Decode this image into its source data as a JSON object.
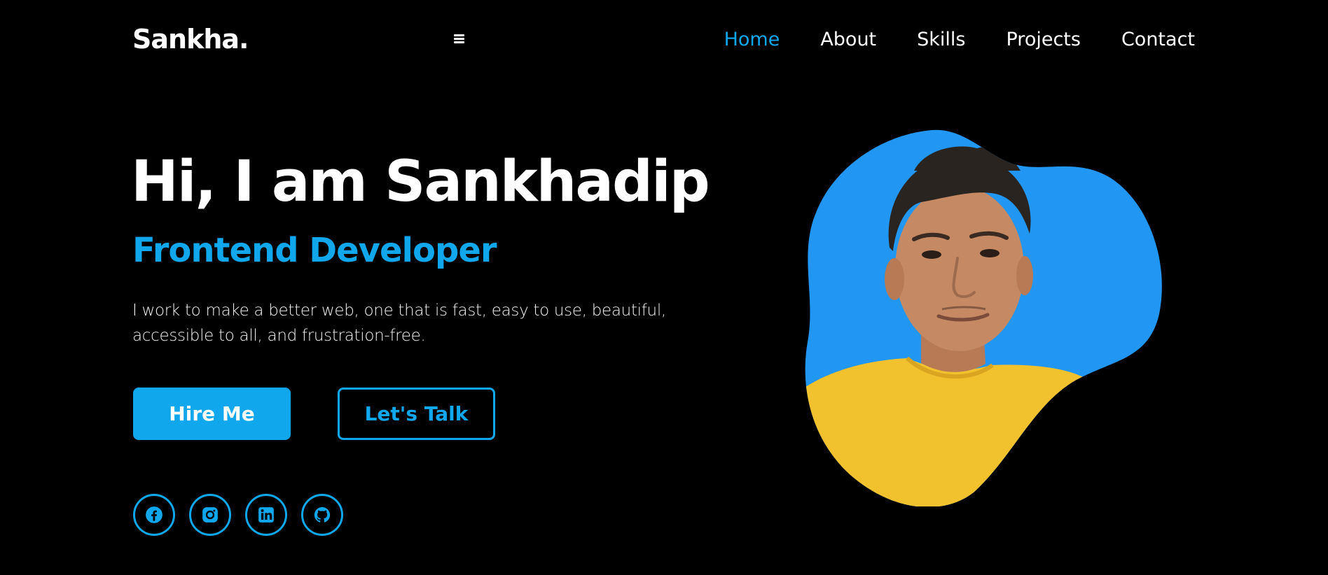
{
  "header": {
    "logo": "Sankha.",
    "menu_icon": "hamburger-menu-icon",
    "nav": [
      {
        "label": "Home",
        "active": true
      },
      {
        "label": "About",
        "active": false
      },
      {
        "label": "Skills",
        "active": false
      },
      {
        "label": "Projects",
        "active": false
      },
      {
        "label": "Contact",
        "active": false
      }
    ]
  },
  "hero": {
    "title": "Hi, I am Sankhadip",
    "role": "Frontend Developer",
    "description": "I work to make a better web, one that is fast, easy to use, beautiful, accessible to all, and frustration-free.",
    "hire_label": "Hire Me",
    "talk_label": "Let's Talk"
  },
  "social": [
    {
      "icon": "facebook-icon"
    },
    {
      "icon": "instagram-icon"
    },
    {
      "icon": "linkedin-icon"
    },
    {
      "icon": "github-icon"
    }
  ],
  "portrait": {
    "icon": "profile-photo"
  },
  "colors": {
    "accent": "#10a7ec",
    "blob": "#2196f3",
    "background": "#000000",
    "shirt": "#f2c12e"
  }
}
